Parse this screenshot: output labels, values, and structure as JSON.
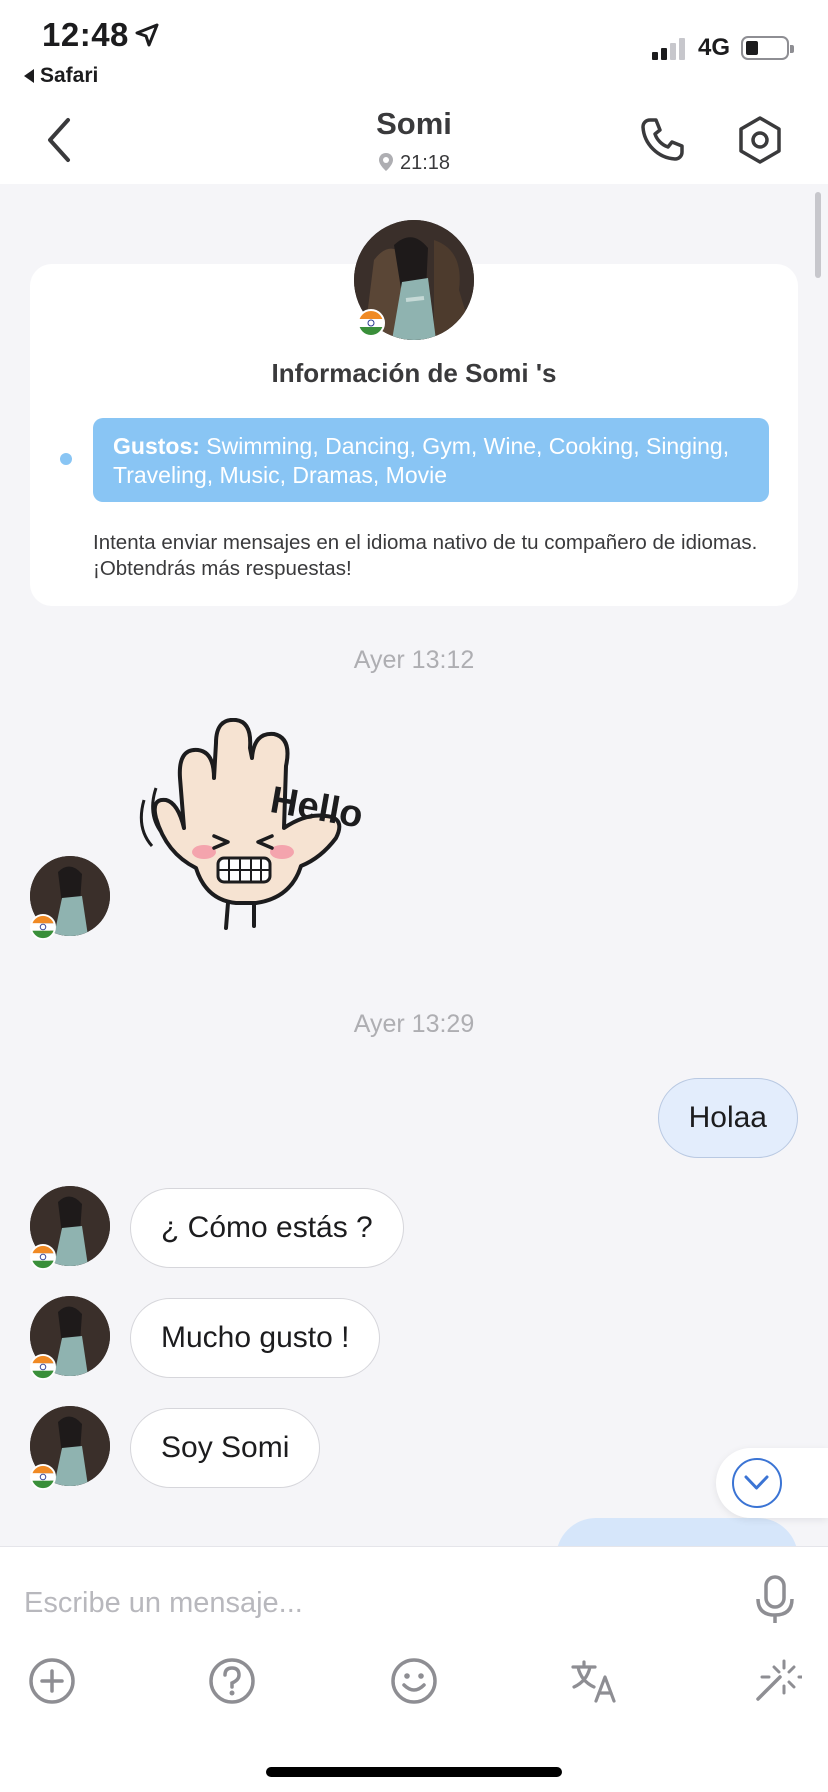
{
  "status_bar": {
    "time": "12:48",
    "back_app": "Safari",
    "network": "4G"
  },
  "header": {
    "title": "Somi",
    "local_time": "21:18"
  },
  "profile_card": {
    "title": "Información de Somi 's",
    "likes_label": "Gustos:",
    "likes_value": " Swimming, Dancing, Gym, Wine, Cooking, Singing, Traveling, Music, Dramas, Movie",
    "tip": "Intenta enviar mensajes en el idioma nativo de tu compañero de idiomas. ¡Obtendrás más respuestas!"
  },
  "chat": {
    "timestamp_1": "Ayer 13:12",
    "sticker_text": "Hello",
    "timestamp_2": "Ayer 13:29",
    "messages": [
      {
        "from": "me",
        "text": "Holaa"
      },
      {
        "from": "partner",
        "text": "¿ Cómo estás ?"
      },
      {
        "from": "partner",
        "text": "Mucho gusto !"
      },
      {
        "from": "partner",
        "text": "Soy Somi"
      }
    ]
  },
  "composer": {
    "placeholder": "Escribe un mensaje..."
  },
  "icons": {
    "back": "chevron-left-icon",
    "phone": "phone-icon",
    "settings": "hexagon-settings-icon",
    "location": "location-pin-icon",
    "mic": "microphone-icon",
    "tools": [
      "plus-circle-icon",
      "question-circle-icon",
      "smiley-icon",
      "translate-icon",
      "magic-wand-icon"
    ]
  },
  "colors": {
    "accent": "#3b74d4",
    "likes_bg": "#89c5f4",
    "outgoing_bubble": "#e3edfc",
    "background": "#f5f5f8"
  }
}
